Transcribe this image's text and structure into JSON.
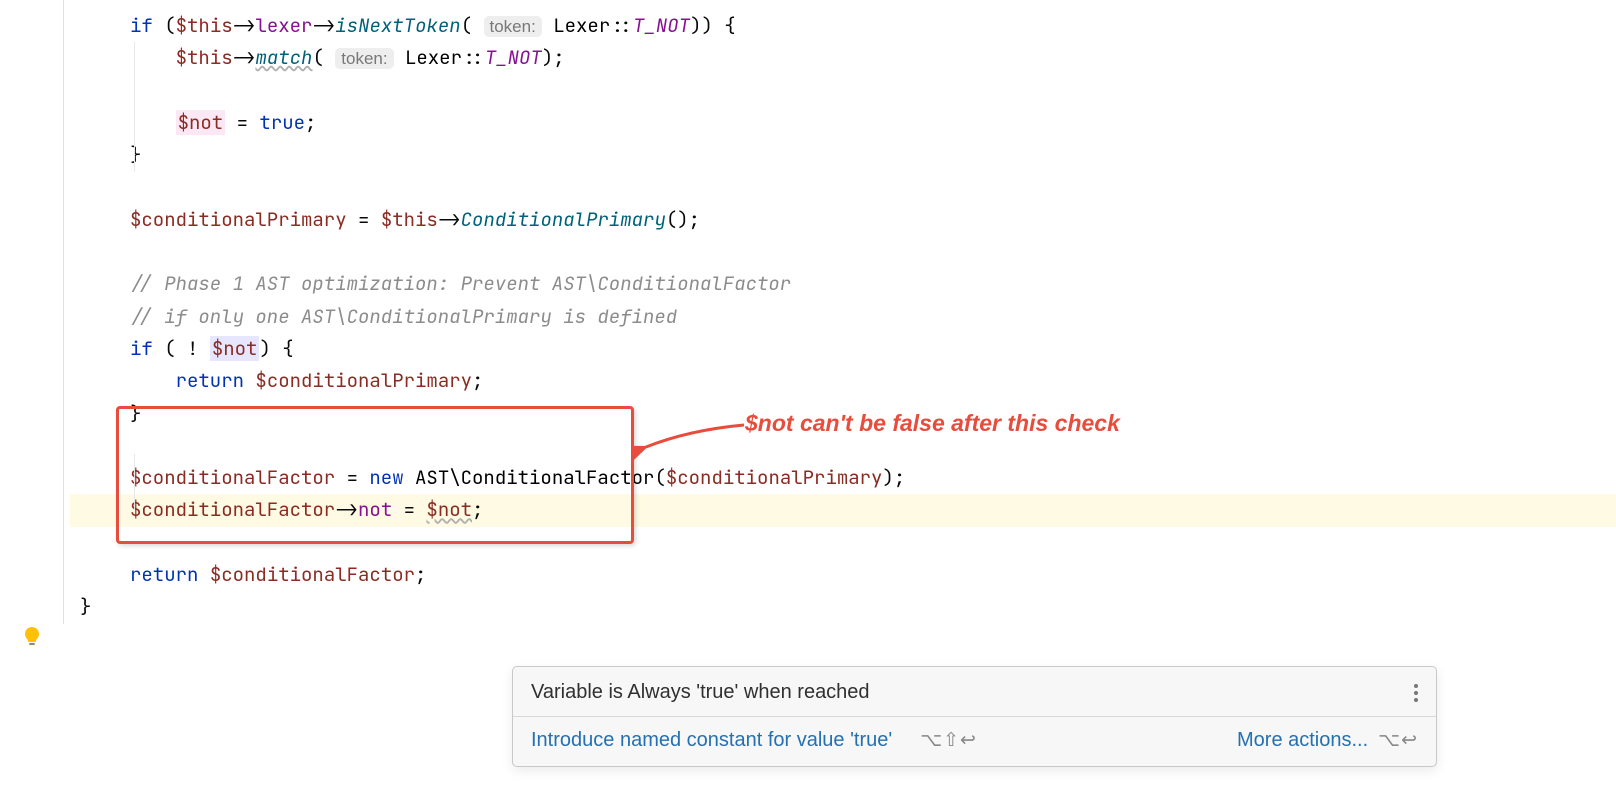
{
  "code": {
    "if": "if",
    "this": "$this",
    "lexer": "lexer",
    "isNextToken": "isNextToken",
    "tokenHint": "token:",
    "lexerType": "Lexer",
    "t_not": "T_NOT",
    "match": "match",
    "notVar": "$not",
    "equals": " = ",
    "true": "true",
    "semi": ";",
    "lbrace": " {",
    "rbrace": "}",
    "conditionalPrimary": "$conditionalPrimary",
    "conditionalPrimaryFn": "ConditionalPrimary",
    "comment1": "// Phase 1 AST optimization: Prevent AST\\ConditionalFactor",
    "comment2": "// if only one AST\\ConditionalPrimary is defined",
    "bang": " ! ",
    "return": "return",
    "conditionalFactor": "$conditionalFactor",
    "new": "new",
    "astNs": "AST\\",
    "conditionalFactorType": "ConditionalFactor",
    "notField": "not"
  },
  "annotation": {
    "text": "$not can't be false after this check"
  },
  "tooltip": {
    "title": "Variable is Always 'true' when reached",
    "action1": "Introduce named constant for value 'true'",
    "shortcut1": "⌥⇧↩",
    "more": "More actions...",
    "shortcut2": "⌥↩"
  }
}
